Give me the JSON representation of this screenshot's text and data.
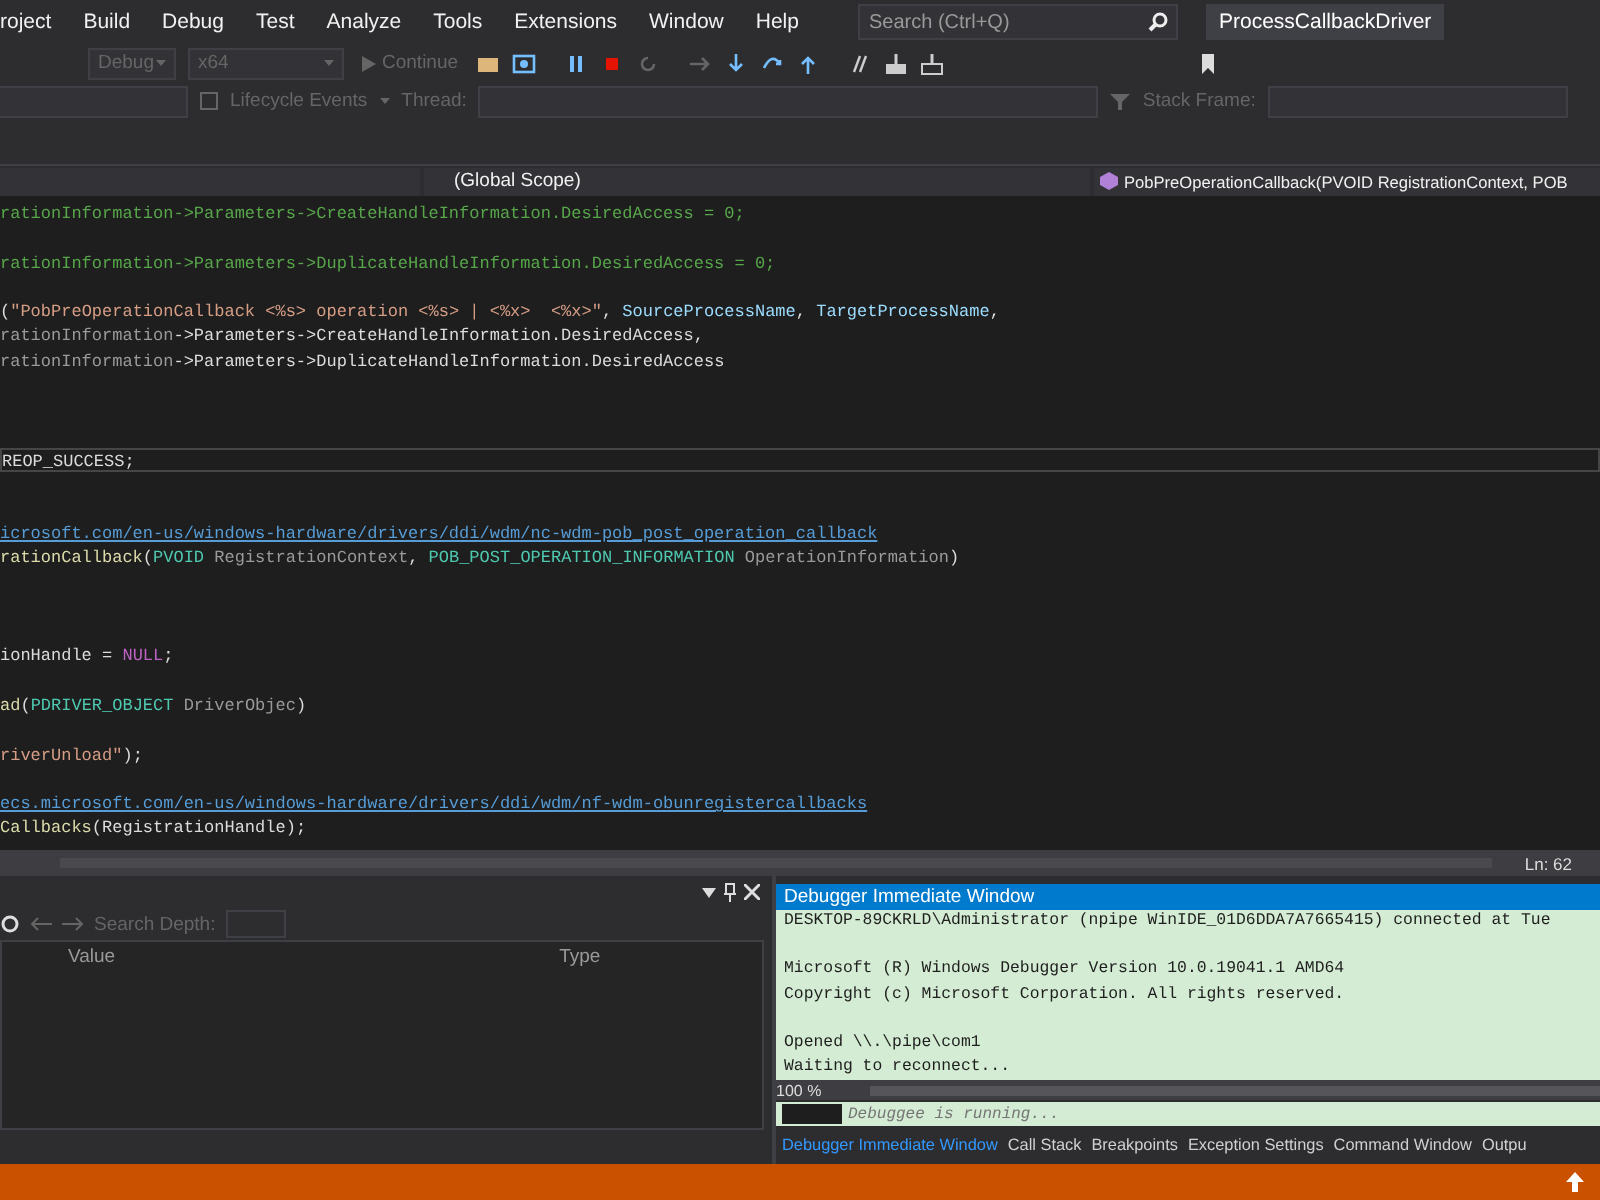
{
  "menu": [
    {
      "label": "roject"
    },
    {
      "label": "Build"
    },
    {
      "label": "Debug"
    },
    {
      "label": "Test"
    },
    {
      "label": "Analyze"
    },
    {
      "label": "Tools"
    },
    {
      "label": "Extensions"
    },
    {
      "label": "Window"
    },
    {
      "label": "Help"
    }
  ],
  "search": {
    "placeholder": "Search (Ctrl+Q)"
  },
  "solution_title": "ProcessCallbackDriver",
  "toolbar": {
    "configuration": {
      "text": "Debug",
      "disabled": true
    },
    "platform": {
      "text": "x64",
      "disabled": true
    },
    "continue": {
      "text": "Continue",
      "disabled": true
    }
  },
  "debug_location": {
    "lifecycle": "Lifecycle Events",
    "thread_label": "Thread:",
    "stack_frame_label": "Stack Frame:"
  },
  "nav_bar": {
    "scope": "(Global Scope)",
    "member": "PobPreOperationCallback(PVOID RegistrationContext, POB"
  },
  "editor": {
    "lines": [
      {
        "kind": "code",
        "highlighted": false,
        "tokens": [
          {
            "kind": "comment",
            "text": "rationInformation->Parameters->CreateHandleInformation.DesiredAccess = 0;"
          }
        ]
      },
      {
        "kind": "blank",
        "highlighted": false
      },
      {
        "kind": "code",
        "highlighted": false,
        "tokens": [
          {
            "kind": "comment",
            "text": "rationInformation->Parameters->DuplicateHandleInformation.DesiredAccess = 0;"
          }
        ]
      },
      {
        "kind": "blank",
        "highlighted": false
      },
      {
        "kind": "code",
        "highlighted": false,
        "tokens": [
          {
            "kind": "plain",
            "text": "("
          },
          {
            "kind": "string",
            "text": "\"PobPreOperationCallback <%s> operation <%s> | <%x>  <%x>\""
          },
          {
            "kind": "plain",
            "text": ", "
          },
          {
            "kind": "ident",
            "text": "SourceProcessName"
          },
          {
            "kind": "plain",
            "text": ", "
          },
          {
            "kind": "ident",
            "text": "TargetProcessName"
          },
          {
            "kind": "plain",
            "text": ","
          }
        ]
      },
      {
        "kind": "code",
        "highlighted": false,
        "tokens": [
          {
            "kind": "param",
            "text": "rationInformation"
          },
          {
            "kind": "plain",
            "text": "->Parameters->CreateHandleInformation.DesiredAccess,"
          }
        ]
      },
      {
        "kind": "code",
        "highlighted": false,
        "tokens": [
          {
            "kind": "param",
            "text": "rationInformation"
          },
          {
            "kind": "plain",
            "text": "->Parameters->DuplicateHandleInformation.DesiredAccess"
          }
        ]
      },
      {
        "kind": "blank",
        "highlighted": false
      },
      {
        "kind": "blank",
        "highlighted": false
      },
      {
        "kind": "blank",
        "highlighted": false
      },
      {
        "kind": "code",
        "highlighted": true,
        "tokens": [
          {
            "kind": "plain",
            "text": "REOP_SUCCESS;"
          }
        ]
      },
      {
        "kind": "blank",
        "highlighted": false
      },
      {
        "kind": "blank",
        "highlighted": false
      },
      {
        "kind": "code",
        "highlighted": false,
        "tokens": [
          {
            "kind": "link",
            "text": "icrosoft.com/en-us/windows-hardware/drivers/ddi/wdm/nc-wdm-pob_post_operation_callback"
          }
        ]
      },
      {
        "kind": "code",
        "highlighted": false,
        "tokens": [
          {
            "kind": "func",
            "text": "rationCallback"
          },
          {
            "kind": "plain",
            "text": "("
          },
          {
            "kind": "type",
            "text": "PVOID"
          },
          {
            "kind": "param",
            "text": " RegistrationContext"
          },
          {
            "kind": "plain",
            "text": ", "
          },
          {
            "kind": "type",
            "text": "POB_POST_OPERATION_INFORMATION"
          },
          {
            "kind": "param",
            "text": " OperationInformation"
          },
          {
            "kind": "plain",
            "text": ")"
          }
        ]
      },
      {
        "kind": "blank",
        "highlighted": false
      },
      {
        "kind": "blank",
        "highlighted": false
      },
      {
        "kind": "blank",
        "highlighted": false
      },
      {
        "kind": "code",
        "highlighted": false,
        "tokens": [
          {
            "kind": "plain",
            "text": "ionHandle = "
          },
          {
            "kind": "macro",
            "text": "NULL"
          },
          {
            "kind": "plain",
            "text": ";"
          }
        ]
      },
      {
        "kind": "blank",
        "highlighted": false
      },
      {
        "kind": "code",
        "highlighted": false,
        "tokens": [
          {
            "kind": "func",
            "text": "ad"
          },
          {
            "kind": "plain",
            "text": "("
          },
          {
            "kind": "type",
            "text": "PDRIVER_OBJECT"
          },
          {
            "kind": "param",
            "text": " DriverObjec"
          },
          {
            "kind": "plain",
            "text": ")"
          }
        ]
      },
      {
        "kind": "blank",
        "highlighted": false
      },
      {
        "kind": "code",
        "highlighted": false,
        "tokens": [
          {
            "kind": "string",
            "text": "riverUnload\""
          },
          {
            "kind": "plain",
            "text": ");"
          }
        ]
      },
      {
        "kind": "blank",
        "highlighted": false
      },
      {
        "kind": "code",
        "highlighted": false,
        "tokens": [
          {
            "kind": "link",
            "text": "ecs.microsoft.com/en-us/windows-hardware/drivers/ddi/wdm/nf-wdm-obunregistercallbacks"
          }
        ]
      },
      {
        "kind": "code",
        "highlighted": false,
        "tokens": [
          {
            "kind": "func",
            "text": "Callbacks"
          },
          {
            "kind": "plain",
            "text": "(RegistrationHandle);"
          }
        ]
      }
    ],
    "position": "Ln: 62"
  },
  "locals_panel": {
    "search_depth_label": "Search Depth:",
    "columns": [
      "Value",
      "Type"
    ]
  },
  "immediate_window": {
    "title": "Debugger Immediate Window",
    "lines": [
      {
        "kind": "text",
        "text": "DESKTOP-89CKRLD\\Administrator (npipe WinIDE_01D6DDA7A7665415) connected at Tue"
      },
      {
        "kind": "blank"
      },
      {
        "kind": "text",
        "text": "Microsoft (R) Windows Debugger Version 10.0.19041.1 AMD64"
      },
      {
        "kind": "text",
        "text": "Copyright (c) Microsoft Corporation. All rights reserved."
      },
      {
        "kind": "blank"
      },
      {
        "kind": "text",
        "text": "Opened \\\\.\\pipe\\com1"
      },
      {
        "kind": "text",
        "text": "Waiting to reconnect..."
      }
    ],
    "zoom": "100 %",
    "input_placeholder": "Debuggee is running..."
  },
  "bottom_tabs": [
    {
      "label": "Debugger Immediate Window",
      "selected": true
    },
    {
      "label": "Call Stack",
      "selected": false
    },
    {
      "label": "Breakpoints",
      "selected": false
    },
    {
      "label": "Exception Settings",
      "selected": false
    },
    {
      "label": "Command Window",
      "selected": false
    },
    {
      "label": "Outpu",
      "selected": false
    }
  ]
}
